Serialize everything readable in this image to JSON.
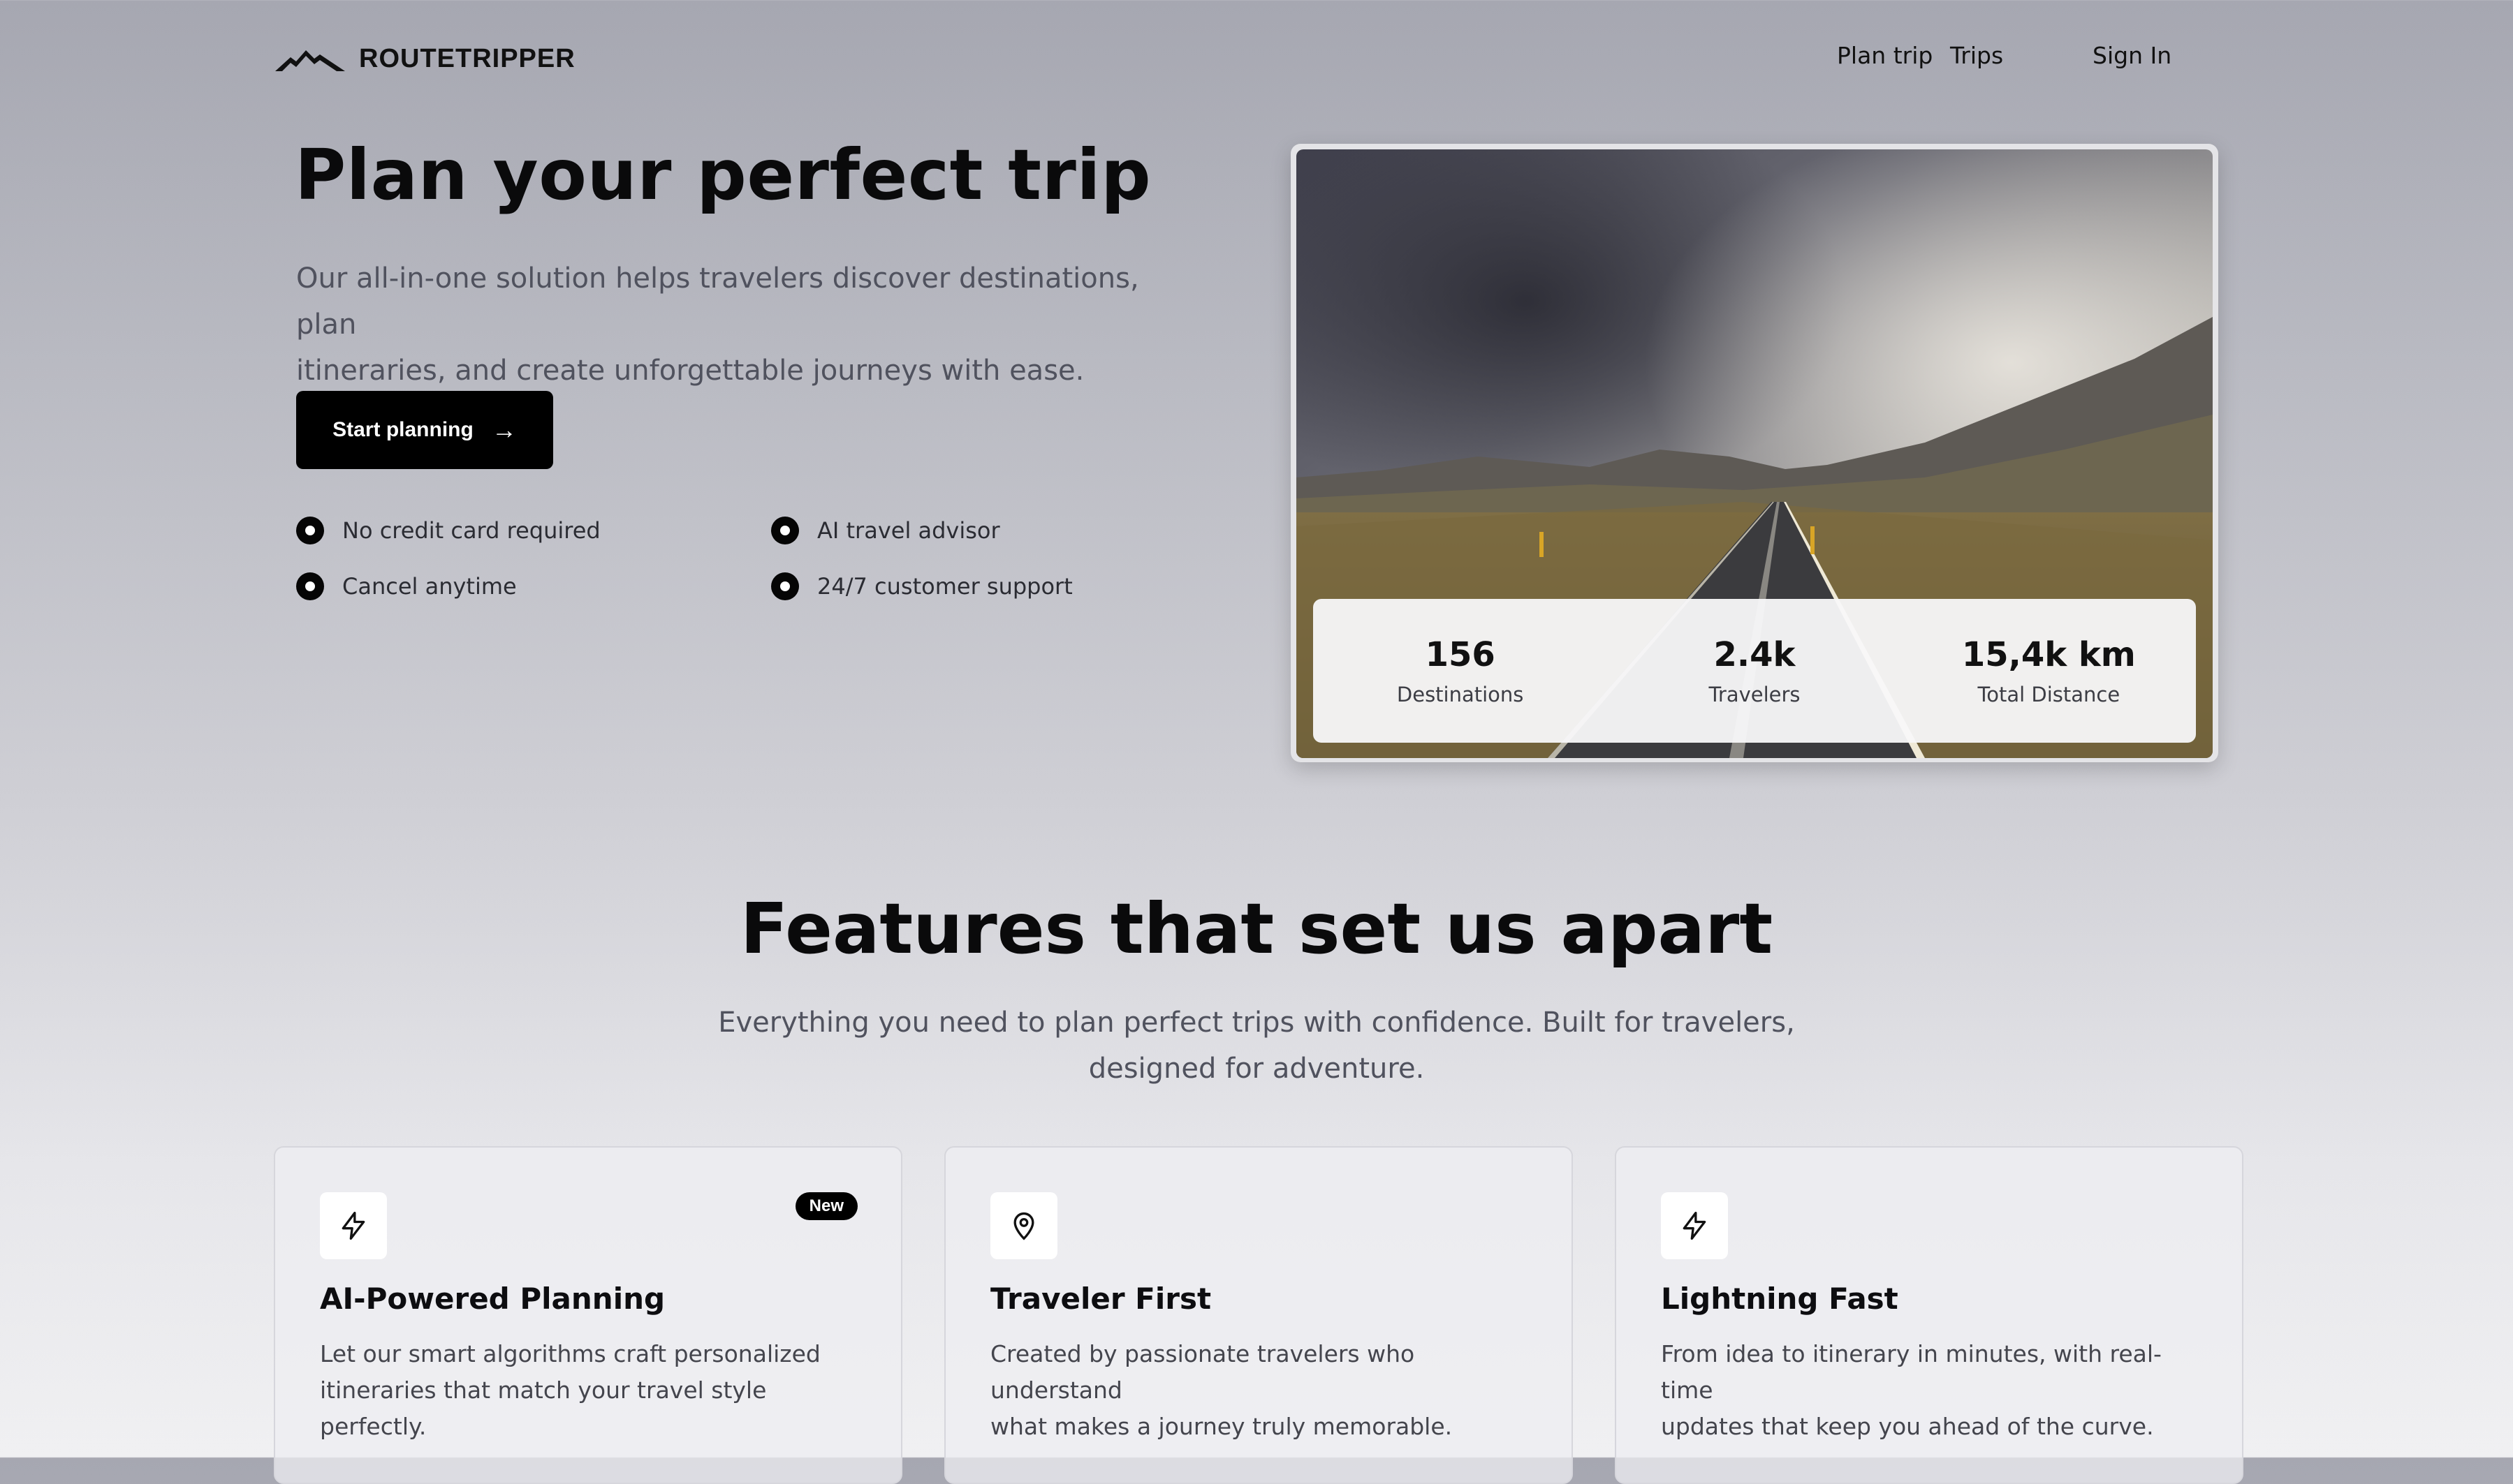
{
  "header": {
    "brand": "ROUTETRIPPER",
    "logo_icon": "mountain-icon",
    "nav": {
      "plan_trip": "Plan trip",
      "trips": "Trips",
      "sign_in": "Sign In"
    }
  },
  "hero": {
    "title": "Plan your perfect trip",
    "subtitle_line1": "Our all-in-one solution helps travelers discover destinations, plan",
    "subtitle_line2": "itineraries, and create unforgettable journeys with ease.",
    "cta_label": "Start planning",
    "cta_icon": "arrow-right-icon",
    "checklist": [
      "No credit card required",
      "AI travel advisor",
      "Cancel anytime",
      "24/7 customer support"
    ]
  },
  "stats": [
    {
      "value": "156",
      "label": "Destinations"
    },
    {
      "value": "2.4k",
      "label": "Travelers"
    },
    {
      "value": "15,4k km",
      "label": "Total Distance"
    }
  ],
  "features": {
    "title": "Features that set us apart",
    "subtitle_line1": "Everything you need to plan perfect trips with confidence. Built for travelers,",
    "subtitle_line2": "designed for adventure.",
    "cards": [
      {
        "icon": "lightning-icon",
        "title": "AI-Powered Planning",
        "badge": "New",
        "text_line1": "Let our smart algorithms craft personalized",
        "text_line2": "itineraries that match your travel style perfectly."
      },
      {
        "icon": "map-pin-icon",
        "title": "Traveler First",
        "text_line1": "Created by passionate travelers who understand",
        "text_line2": "what makes a journey truly memorable."
      },
      {
        "icon": "lightning-icon",
        "title": "Lightning Fast",
        "text_line1": "From idea to itinerary in minutes, with real-time",
        "text_line2": "updates that keep you ahead of the curve."
      }
    ]
  },
  "colors": {
    "accent": "#000000",
    "muted_text": "#50525e"
  }
}
